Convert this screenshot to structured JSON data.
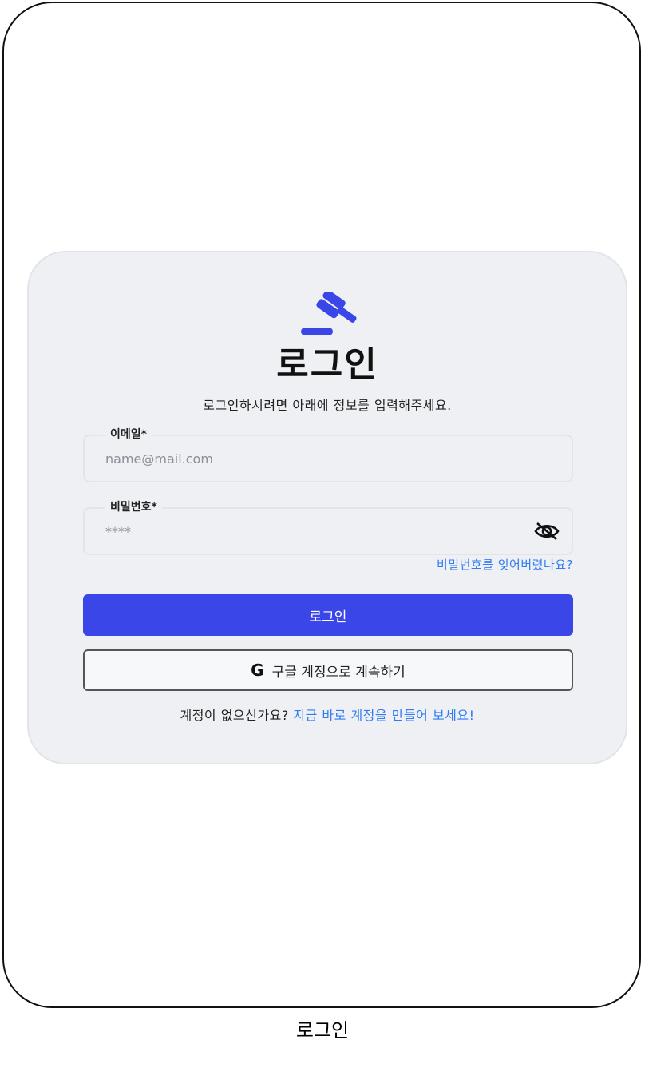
{
  "login": {
    "title": "로그인",
    "subtitle": "로그인하시려면 아래에 정보를 입력해주세요.",
    "email": {
      "label": "이메일*",
      "placeholder": "name@mail.com"
    },
    "password": {
      "label": "비밀번호*",
      "placeholder": "****"
    },
    "forgot_password": "비밀번호를 잊어버렸나요?",
    "login_button": "로그인",
    "google_icon": "G",
    "google_button": "구글 계정으로 계속하기",
    "no_account": "계정이 없으신가요?",
    "signup_link": "지금 바로 계정을 만들어 보세요!"
  },
  "caption": "로그인",
  "colors": {
    "accent": "#3a46e8",
    "link": "#2f7cf5",
    "card": "#eff0f4"
  },
  "icons": {
    "logo": "gavel-icon",
    "password_toggle": "eye-off-icon"
  }
}
